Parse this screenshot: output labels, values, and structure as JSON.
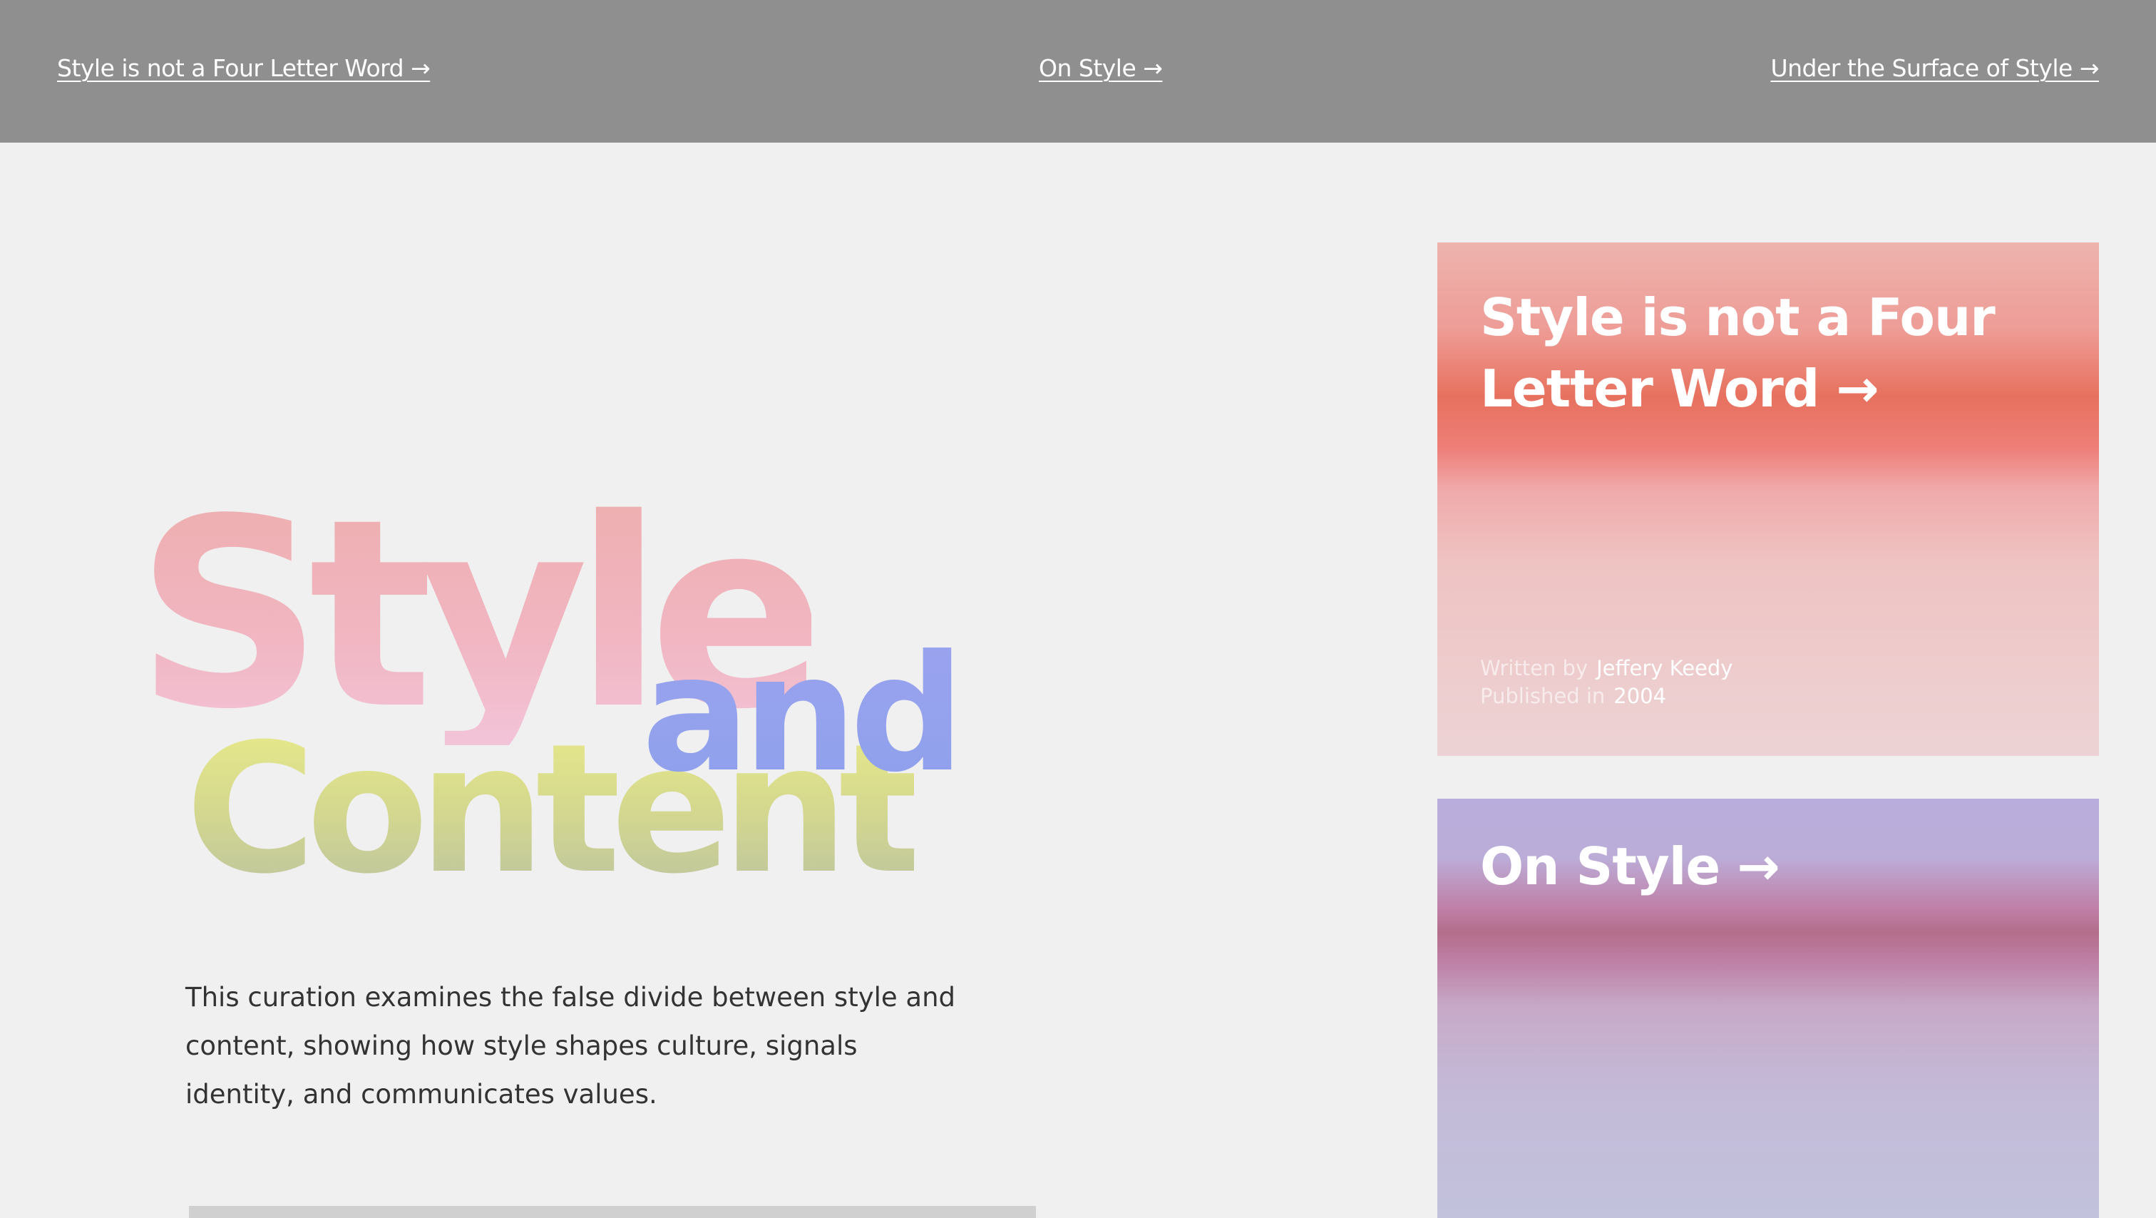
{
  "nav": {
    "links": [
      {
        "label": "Style is not a Four Letter Word →"
      },
      {
        "label": "On Style →"
      },
      {
        "label": "Under the Surface of Style →"
      }
    ]
  },
  "hero": {
    "word_1": "Style",
    "word_2": "and",
    "word_3": "Content"
  },
  "description": "This curation examines the false divide between style and content, showing how style shapes culture, signals identity, and communicates values.",
  "cards": [
    {
      "title": "Style is not a Four Letter Word →",
      "written_by_label": "Written by",
      "author": "Jeffery Keedy",
      "published_label": "Published in",
      "year": "2004"
    },
    {
      "title": "On Style →"
    }
  ],
  "colors": {
    "nav_background": "#8f8f8f",
    "page_background": "#f0f0f0",
    "style_pink": "#eeaeae",
    "and_blue": "#9aa3ee",
    "content_yellow": "#e9ea8a",
    "card1_red": "#e7715e",
    "card2_purple": "#b9addd"
  }
}
